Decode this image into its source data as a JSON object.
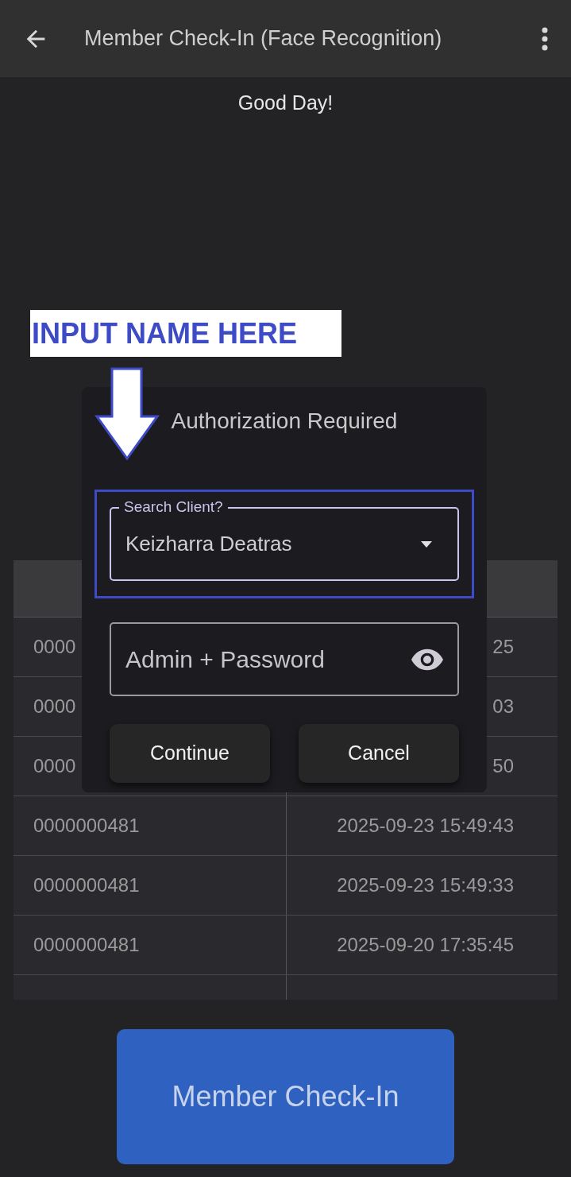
{
  "app_bar": {
    "title": "Member Check-In (Face Recognition)"
  },
  "greeting": "Good Day!",
  "table": {
    "rows": [
      {
        "cells": [
          "0000",
          "25"
        ]
      },
      {
        "cells": [
          "0000",
          "03"
        ]
      },
      {
        "cells": [
          "0000",
          "50"
        ]
      },
      {
        "cells": [
          "0000000481",
          "2025-09-23 15:49:43"
        ]
      },
      {
        "cells": [
          "0000000481",
          "2025-09-23 15:49:33"
        ]
      },
      {
        "cells": [
          "0000000481",
          "2025-09-20 17:35:45"
        ]
      }
    ]
  },
  "dialog": {
    "title": "Authorization Required",
    "search_field": {
      "label": "Search Client?",
      "value": "Keizharra Deatras"
    },
    "password_field": {
      "placeholder": "Admin + Password"
    },
    "buttons": [
      "Continue",
      "Cancel"
    ]
  },
  "annotation": {
    "text": "INPUT NAME HERE"
  },
  "check_in_button": "Member Check-In"
}
